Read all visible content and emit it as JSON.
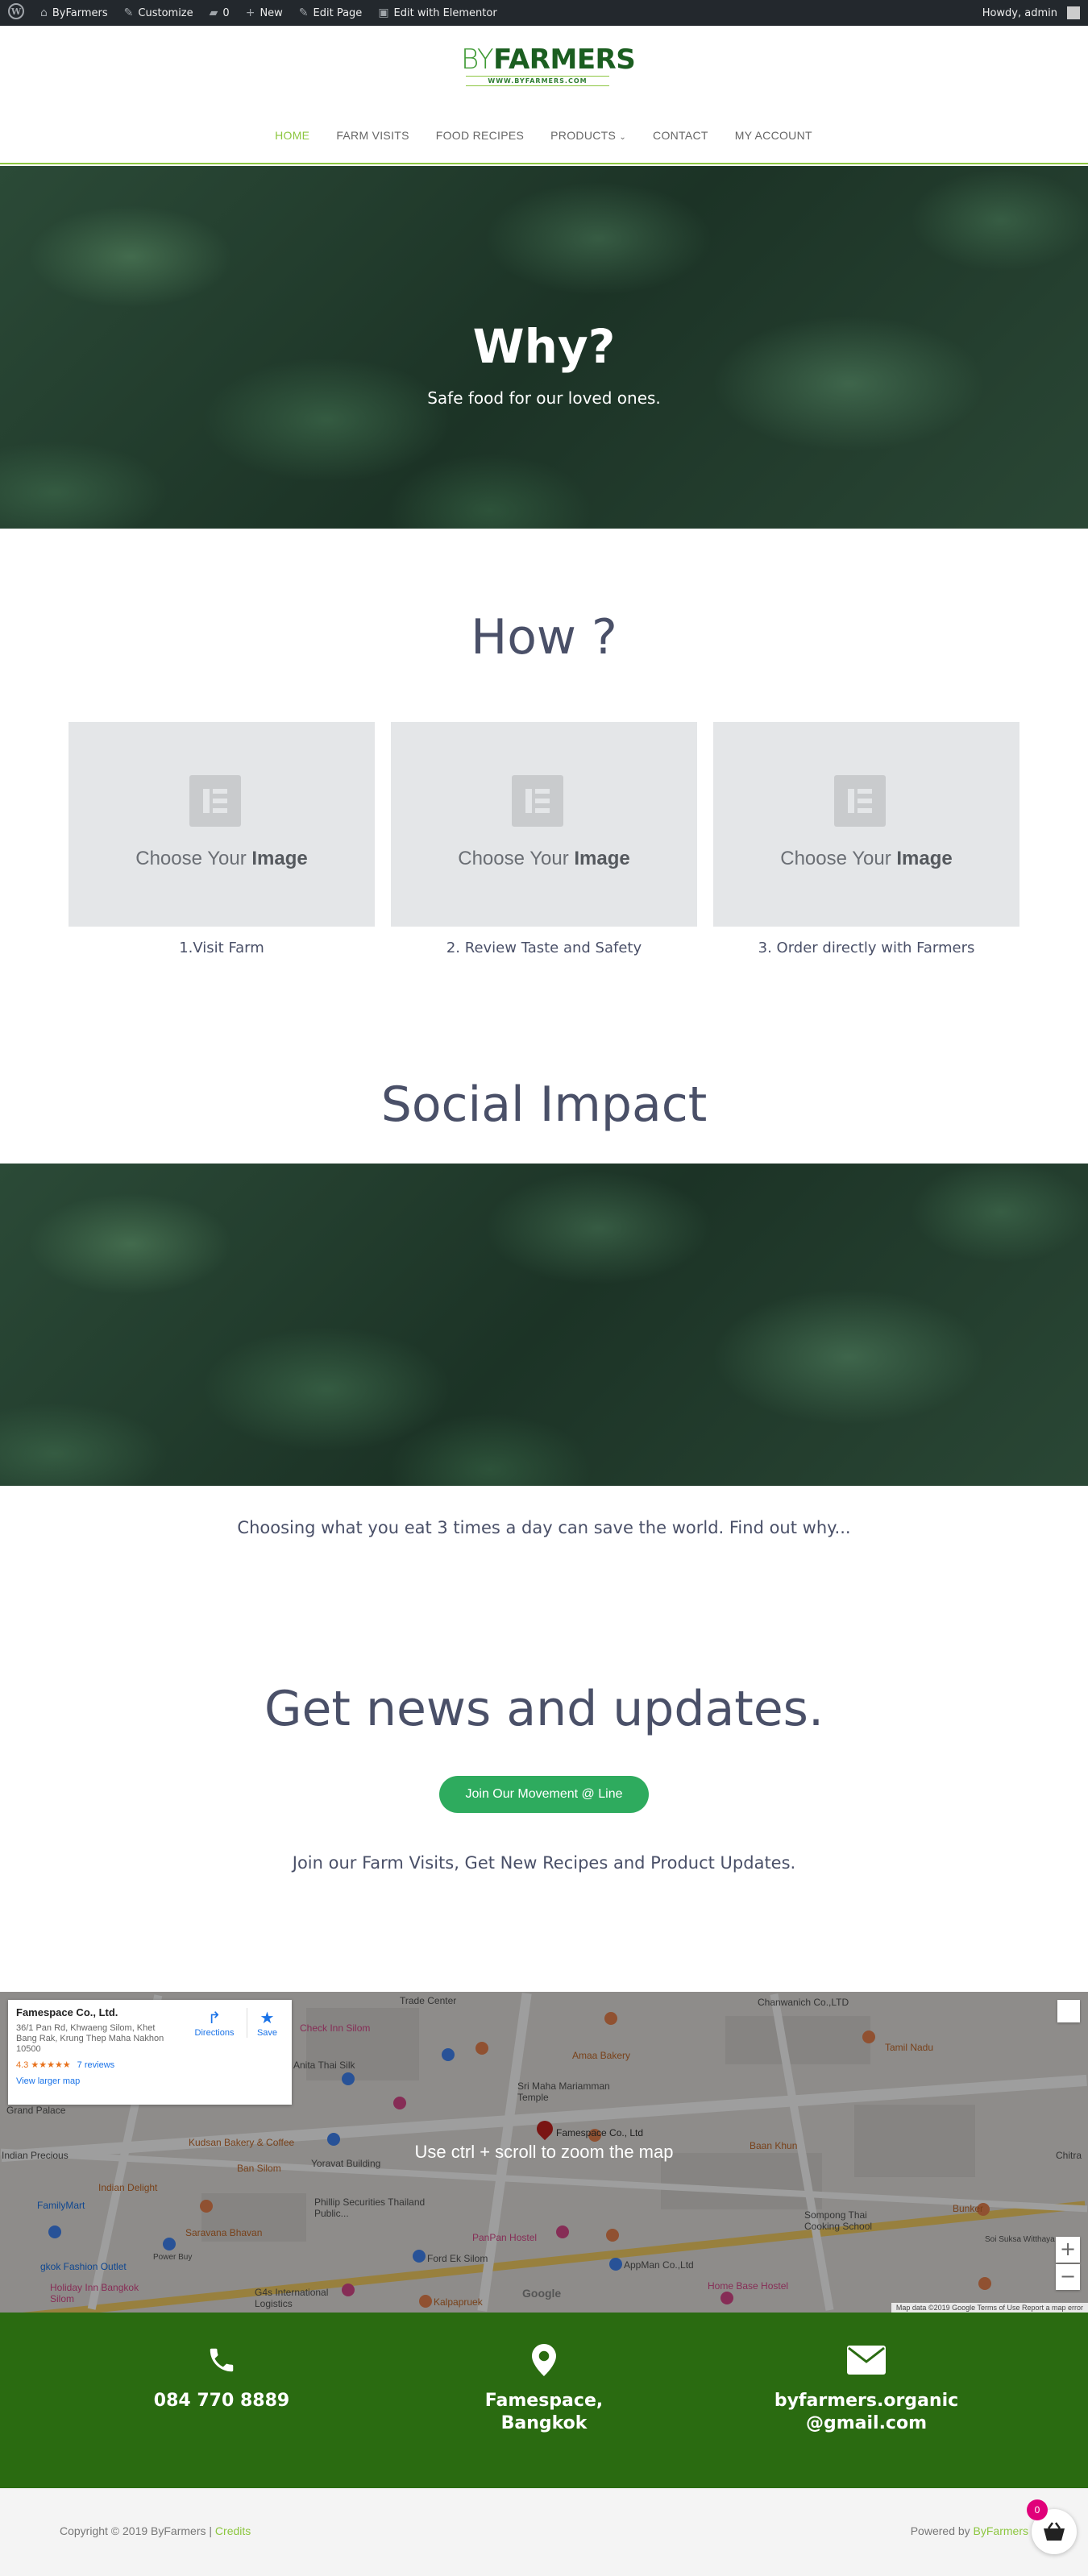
{
  "adminbar": {
    "site": "ByFarmers",
    "customize": "Customize",
    "comments": "0",
    "new": "New",
    "edit_page": "Edit Page",
    "edit_elementor": "Edit with Elementor",
    "howdy": "Howdy, admin"
  },
  "header": {
    "logo_light": "BY",
    "logo_bold": "FARMERS",
    "logo_sub": "WWW.BYFARMERS.COM",
    "nav": [
      "HOME",
      "FARM VISITS",
      "FOOD RECIPES",
      "PRODUCTS",
      "CONTACT",
      "MY ACCOUNT"
    ],
    "active_nav": "HOME"
  },
  "hero": {
    "title": "Why?",
    "subtitle": "Safe food for our loved ones."
  },
  "how": {
    "title": "How ?",
    "placeholder_light": "Choose Your ",
    "placeholder_bold": "Image",
    "steps": [
      "1.Visit Farm",
      "2. Review Taste and Safety",
      "3. Order directly with Farmers"
    ]
  },
  "social": {
    "title": "Social Impact",
    "text": "Choosing what you eat 3 times a day can save the world. Find out why..."
  },
  "news": {
    "title": "Get news and updates.",
    "button": "Join Our Movement @ Line",
    "text": "Join our Farm Visits, Get New Recipes and Product Updates."
  },
  "map": {
    "place_name": "Famespace Co., Ltd.",
    "address": "36/1 Pan Rd, Khwaeng Silom, Khet Bang Rak, Krung Thep Maha Nakhon 10500",
    "rating": "4.3",
    "stars": "★★★★★",
    "reviews": "7 reviews",
    "larger_map": "View larger map",
    "directions": "Directions",
    "save": "Save",
    "hint": "Use ctrl + scroll to zoom the map",
    "google": "Google",
    "footer": "Map data ©2019 Google    Terms of Use    Report a map error",
    "labels": {
      "trade_center": "Trade Center",
      "chanwanich": "Chanwanich Co.,LTD",
      "check_inn": "Check Inn Silom",
      "anita": "Anita Thai Silk",
      "amaa": "Amaa Bakery",
      "tamil": "Tamil Nadu",
      "grand_palace": "Grand Palace",
      "sri_maha": "Sri Maha Mariamman Temple",
      "famespace": "Famespace Co., Ltd",
      "kudsan": "Kudsan Bakery & Coffee",
      "ban_silom": "Ban Silom",
      "indian_delight": "Indian Delight",
      "indian_precious": "Indian Precious",
      "ban_khun": "Baan Khun",
      "yoravat": "Yoravat Building",
      "phillip": "Phillip Securities Thailand Public...",
      "familymart": "FamilyMart",
      "saravana": "Saravana Bhavan",
      "panpan": "PanPan Hostel",
      "sompong": "Sompong Thai Cooking School",
      "bunker": "Bunker",
      "ford": "Ford Ek Silom",
      "appman": "AppMan Co.,Ltd",
      "fashion_outlet": "gkok Fashion Outlet",
      "power_buy": "Power Buy",
      "holiday_inn": "Holiday Inn Bangkok Silom",
      "g4s": "G4s International Logistics",
      "home_base": "Home Base Hostel",
      "kalpapruek": "Kalpapruek",
      "soi_suksa": "Soi Suksa Witthaya",
      "chitra": "Chitra"
    }
  },
  "contact": {
    "phone": "084 770 8889",
    "location": "Famespace,\nBangkok",
    "email": "byfarmers.organic\n@gmail.com"
  },
  "footer": {
    "copyright": "Copyright © 2019 ByFarmers | ",
    "credits": "Credits",
    "powered_by": "Powered by ",
    "powered_brand": "ByFarmers",
    "cart_count": "0"
  },
  "colors": {
    "brand_green": "#8cc63f",
    "dark_green": "#2a6b11",
    "button_green": "#2eab5e",
    "heading": "#4a5068",
    "cart_badge": "#e0007a"
  }
}
